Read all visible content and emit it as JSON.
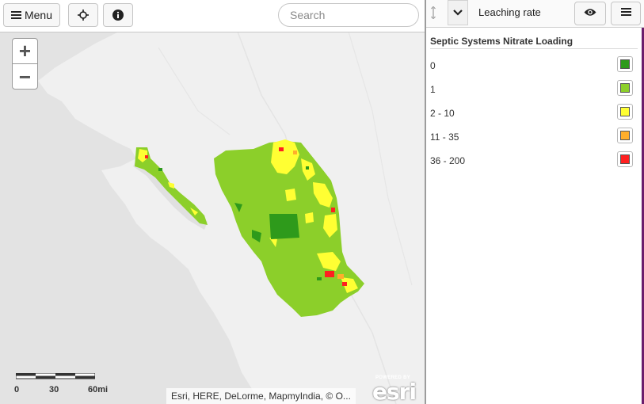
{
  "toolbar": {
    "menu_label": "Menu",
    "menu_icon": "hamburger-icon",
    "locate_icon": "crosshair-icon",
    "info_icon": "info-icon"
  },
  "search": {
    "placeholder": "Search",
    "value": ""
  },
  "zoom": {
    "in_label": "+",
    "out_label": "−"
  },
  "scalebar": {
    "labels": [
      "0",
      "30",
      "60mi"
    ]
  },
  "attribution": "Esri, HERE, DeLorme, MapmyIndia, © O...",
  "esri_logo": {
    "powered_by": "POWERED BY",
    "brand": "esri"
  },
  "layer_panel": {
    "layer_name": "Leaching rate",
    "drag_icon": "drag-handle-icon",
    "expand_icon": "chevron-down-icon",
    "visibility_icon": "eye-icon",
    "menu_icon": "hamburger-icon"
  },
  "legend": {
    "title": "Septic Systems Nitrate Loading",
    "items": [
      {
        "label": "0",
        "color": "#2e9a1b"
      },
      {
        "label": "1",
        "color": "#8ccf2a"
      },
      {
        "label": "2 - 10",
        "color": "#ffff33"
      },
      {
        "label": "11 - 35",
        "color": "#ffae2b"
      },
      {
        "label": "36 - 200",
        "color": "#ff2020"
      }
    ]
  },
  "colors": {
    "ocean": "#e3e3e3",
    "land": "#f2f2f2",
    "panel_accent": "#6c1d6c"
  }
}
